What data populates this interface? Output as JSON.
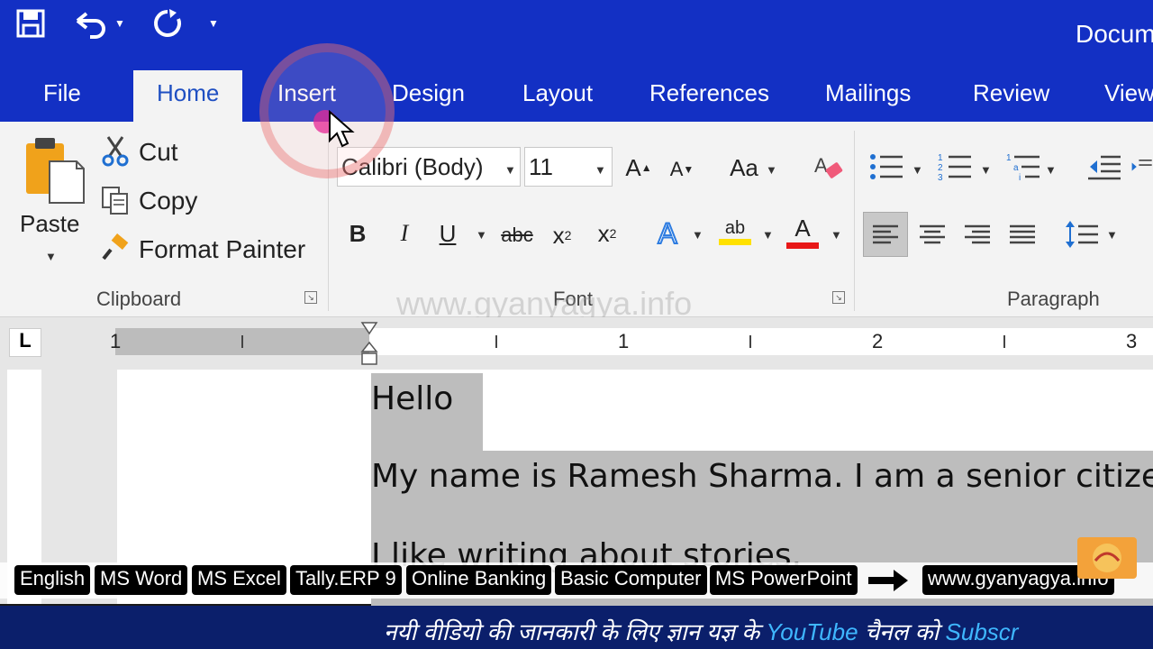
{
  "window": {
    "title": "Docum"
  },
  "qat": {
    "save": "save-icon",
    "undo": "undo-icon",
    "redo": "redo-icon",
    "more": "customize-qat-icon"
  },
  "tabs": [
    {
      "label": "File"
    },
    {
      "label": "Home"
    },
    {
      "label": "Insert"
    },
    {
      "label": "Design"
    },
    {
      "label": "Layout"
    },
    {
      "label": "References"
    },
    {
      "label": "Mailings"
    },
    {
      "label": "Review"
    },
    {
      "label": "View"
    }
  ],
  "clipboard": {
    "paste": "Paste",
    "cut": "Cut",
    "copy": "Copy",
    "format_painter": "Format Painter",
    "group_label": "Clipboard"
  },
  "font": {
    "font_name": "Calibri (Body)",
    "font_size": "11",
    "change_case": "Aa",
    "bold": "B",
    "italic": "I",
    "underline": "U",
    "strike": "abc",
    "subscript": "x",
    "subscript_mark": "2",
    "superscript": "x",
    "superscript_mark": "2",
    "grow": "A",
    "shrink": "A",
    "text_effects": "A",
    "highlight": "ab",
    "font_color": "A",
    "group_label": "Font"
  },
  "paragraph": {
    "group_label": "Paragraph"
  },
  "watermark": "www.gyanyagya.info",
  "ruler": {
    "numbers": [
      "1",
      "1",
      "2",
      "3"
    ]
  },
  "document": {
    "lines": [
      "Hello",
      "My name is Ramesh Sharma. I am a senior citizen",
      "I like writing about stories."
    ]
  },
  "tags": [
    "English",
    "MS Word",
    "MS Excel",
    "Tally.ERP 9",
    "Online Banking",
    "Basic Computer",
    "MS PowerPoint",
    "www.gyanyagya.info"
  ],
  "ticker": {
    "prefix": "नयी वीडियो की जानकारी के लिए ज्ञान यज्ञ के ",
    "youtube": "YouTube",
    "middle": " चैनल को ",
    "subscribe": "Subscr"
  },
  "colors": {
    "title_bar": "#1330c4",
    "ribbon": "#f3f3f3",
    "accent": "#1f4fc2",
    "selection": "#bdbdbd"
  }
}
